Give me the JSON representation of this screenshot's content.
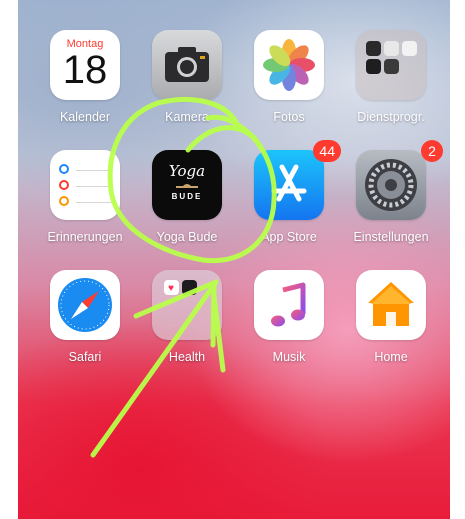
{
  "apps": [
    {
      "label": "Kalender",
      "icon": "calendar-icon",
      "weekday": "Montag",
      "day": "18"
    },
    {
      "label": "Kamera",
      "icon": "camera-icon"
    },
    {
      "label": "Fotos",
      "icon": "photos-icon"
    },
    {
      "label": "Dienstprogr.",
      "icon": "utilities-folder-icon"
    },
    {
      "label": "Erinnerungen",
      "icon": "reminders-icon"
    },
    {
      "label": "Yoga Bude",
      "icon": "yoga-bude-icon",
      "logo_text": [
        "Yoga",
        "BUDE"
      ]
    },
    {
      "label": "App Store",
      "icon": "app-store-icon",
      "badge": "44"
    },
    {
      "label": "Einstellungen",
      "icon": "settings-icon",
      "badge": "2"
    },
    {
      "label": "Safari",
      "icon": "safari-icon"
    },
    {
      "label": "Health",
      "icon": "health-icon"
    },
    {
      "label": "Musik",
      "icon": "music-icon"
    },
    {
      "label": "Home",
      "icon": "home-icon"
    }
  ],
  "colors": {
    "badge": "#ff3b30",
    "annotation": "#b9ff4a",
    "calendar_weekday": "#ff3b30"
  }
}
